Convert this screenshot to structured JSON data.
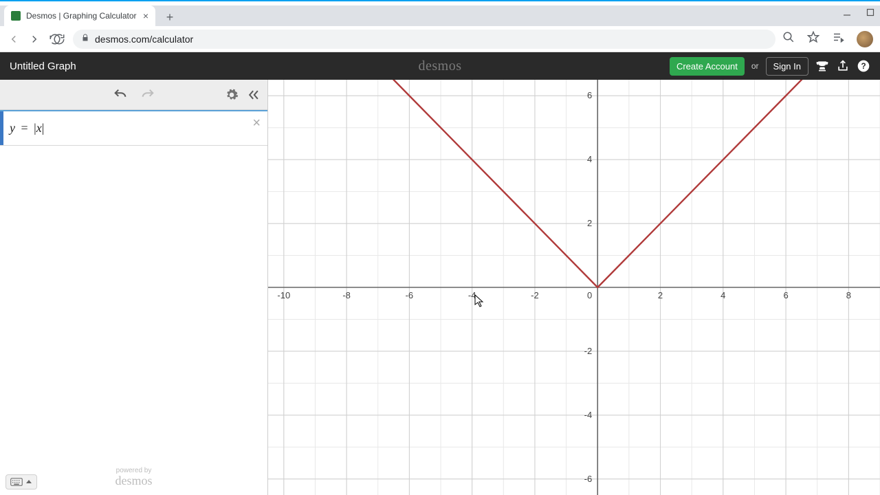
{
  "browser": {
    "tab_title": "Desmos | Graphing Calculator",
    "url": "desmos.com/calculator"
  },
  "header": {
    "title": "Untitled Graph",
    "brand": "desmos",
    "create_account": "Create Account",
    "or": "or",
    "sign_in": "Sign In"
  },
  "expression": {
    "display": "y = |x|"
  },
  "footer": {
    "powered_by": "powered by",
    "brand": "desmos"
  },
  "chart_data": {
    "type": "line",
    "title": "",
    "function": "y = |x|",
    "x_range": [
      -10.5,
      9.0
    ],
    "y_range": [
      -6.5,
      6.5
    ],
    "x_ticks": [
      -10,
      -8,
      -6,
      -4,
      -2,
      0,
      2,
      4,
      6,
      8
    ],
    "y_ticks": [
      -6,
      -4,
      -2,
      0,
      2,
      4,
      6
    ],
    "minor_grid_step": 1,
    "series": [
      {
        "name": "|x|",
        "color": "#b03a3a",
        "points": [
          [
            -10,
            10
          ],
          [
            -8,
            8
          ],
          [
            -6,
            6
          ],
          [
            -4,
            4
          ],
          [
            -2,
            2
          ],
          [
            0,
            0
          ],
          [
            2,
            2
          ],
          [
            4,
            4
          ],
          [
            6,
            6
          ],
          [
            8,
            8
          ],
          [
            10,
            10
          ]
        ]
      }
    ],
    "origin_label": "0"
  }
}
